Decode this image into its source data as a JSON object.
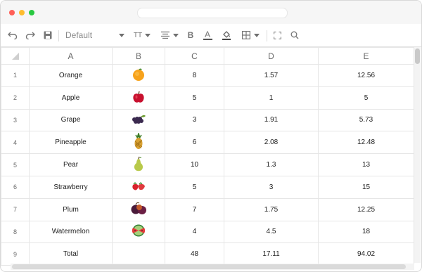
{
  "window": {
    "url_text": ""
  },
  "toolbar": {
    "font_name": "Default",
    "items": [
      "undo-icon",
      "redo-icon",
      "save-icon",
      "font-size-icon",
      "align-icon",
      "bold-icon",
      "font-color-icon",
      "fill-color-icon",
      "borders-icon",
      "fullscreen-icon",
      "search-icon"
    ],
    "bold_label": "B",
    "font_size_label": "TT",
    "font_color_label": "A"
  },
  "sheet": {
    "columns": [
      "A",
      "B",
      "C",
      "D",
      "E"
    ],
    "rows": [
      {
        "num": "1",
        "a": "Orange",
        "fruit": "orange",
        "c": "8",
        "d": "1.57",
        "e": "12.56"
      },
      {
        "num": "2",
        "a": "Apple",
        "fruit": "apple",
        "c": "5",
        "d": "1",
        "e": "5"
      },
      {
        "num": "3",
        "a": "Grape",
        "fruit": "grape",
        "c": "3",
        "d": "1.91",
        "e": "5.73"
      },
      {
        "num": "4",
        "a": "Pineapple",
        "fruit": "pineapple",
        "c": "6",
        "d": "2.08",
        "e": "12.48"
      },
      {
        "num": "5",
        "a": "Pear",
        "fruit": "pear",
        "c": "10",
        "d": "1.3",
        "e": "13"
      },
      {
        "num": "6",
        "a": "Strawberry",
        "fruit": "strawberry",
        "c": "5",
        "d": "3",
        "e": "15"
      },
      {
        "num": "7",
        "a": "Plum",
        "fruit": "plum",
        "c": "7",
        "d": "1.75",
        "e": "12.25"
      },
      {
        "num": "8",
        "a": "Watermelon",
        "fruit": "watermelon",
        "c": "4",
        "d": "4.5",
        "e": "18"
      },
      {
        "num": "9",
        "a": "Total",
        "fruit": "",
        "c": "48",
        "d": "17.11",
        "e": "94.02"
      }
    ]
  }
}
